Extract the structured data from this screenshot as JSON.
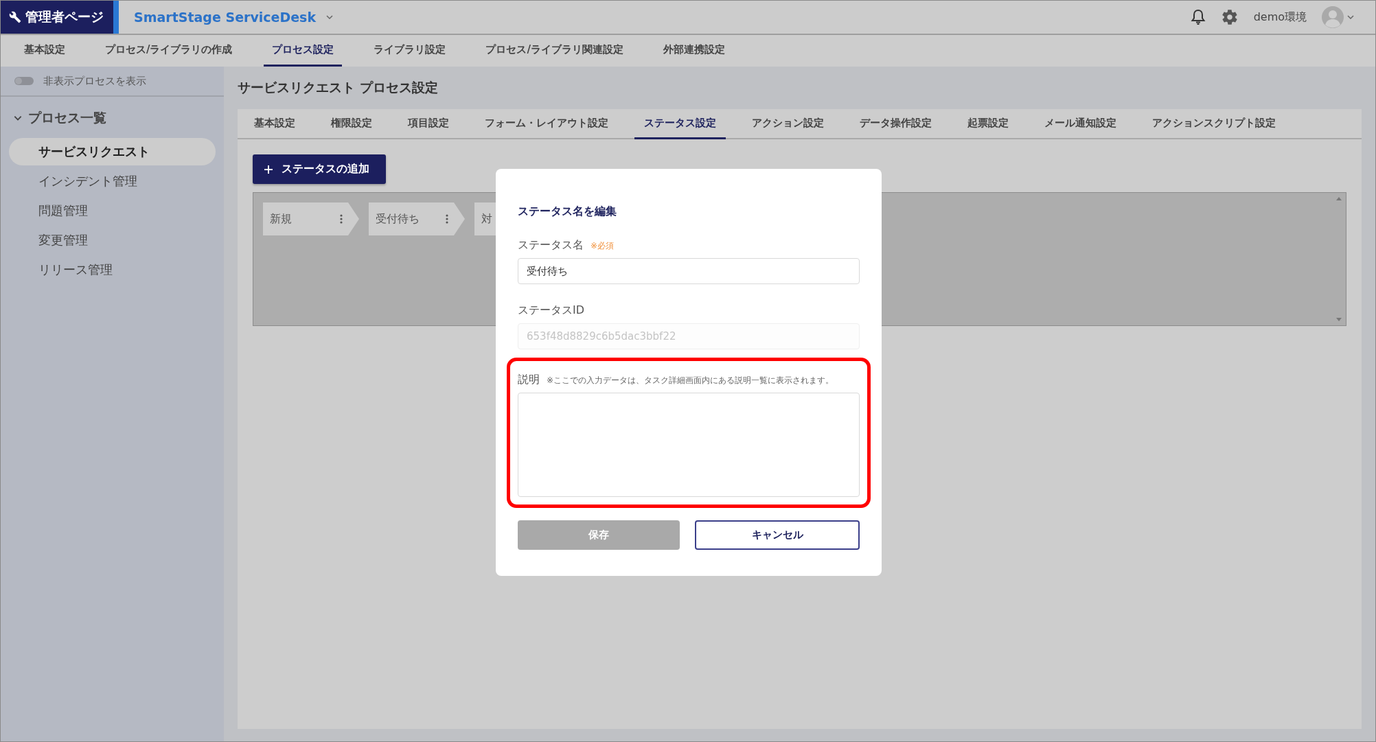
{
  "header": {
    "admin_label": "管理者ページ",
    "app_name": "SmartStage ServiceDesk",
    "env_label": "demo環境"
  },
  "nav_tabs": [
    {
      "label": "基本設定",
      "selected": false
    },
    {
      "label": "プロセス/ライブラリの作成",
      "selected": false
    },
    {
      "label": "プロセス設定",
      "selected": true
    },
    {
      "label": "ライブラリ設定",
      "selected": false
    },
    {
      "label": "プロセス/ライブラリ関連設定",
      "selected": false
    },
    {
      "label": "外部連携設定",
      "selected": false
    }
  ],
  "sidebar": {
    "toggle": {
      "label": "非表示プロセスを表示",
      "on": false
    },
    "group": {
      "label": "プロセス一覧",
      "expanded": true
    },
    "items": [
      {
        "label": "サービスリクエスト",
        "selected": true
      },
      {
        "label": "インシデント管理",
        "selected": false
      },
      {
        "label": "問題管理",
        "selected": false
      },
      {
        "label": "変更管理",
        "selected": false
      },
      {
        "label": "リリース管理",
        "selected": false
      }
    ]
  },
  "page_title": "サービスリクエスト プロセス設定",
  "process_tabs": [
    {
      "label": "基本設定",
      "selected": false
    },
    {
      "label": "権限設定",
      "selected": false
    },
    {
      "label": "項目設定",
      "selected": false
    },
    {
      "label": "フォーム・レイアウト設定",
      "selected": false
    },
    {
      "label": "ステータス設定",
      "selected": true
    },
    {
      "label": "アクション設定",
      "selected": false
    },
    {
      "label": "データ操作設定",
      "selected": false
    },
    {
      "label": "起票設定",
      "selected": false
    },
    {
      "label": "メール通知設定",
      "selected": false
    },
    {
      "label": "アクションスクリプト設定",
      "selected": false
    }
  ],
  "add_button": "ステータスの追加",
  "statuses": [
    {
      "name": "新規"
    },
    {
      "name": "受付待ち"
    },
    {
      "name": "対"
    }
  ],
  "dialog": {
    "title": "ステータス名を編集",
    "fields": [
      {
        "kind": "input",
        "label": "ステータス名",
        "note": "※必須",
        "value": "受付待ち",
        "disabled": false,
        "highlighted": false
      },
      {
        "kind": "input",
        "label": "ステータスID",
        "value": "653f48d8829c6b5dac3bbf22",
        "disabled": true,
        "highlighted": false
      },
      {
        "kind": "textarea",
        "label": "説明",
        "note": "※ここでの入力データは、タスク詳細画面内にある説明一覧に表示されます。",
        "disabled": false,
        "highlighted": true
      }
    ],
    "buttons": [
      {
        "label": "保存",
        "kind": "primary",
        "disabled": true
      },
      {
        "label": "キャンセル",
        "kind": "secondary",
        "disabled": false
      }
    ]
  }
}
